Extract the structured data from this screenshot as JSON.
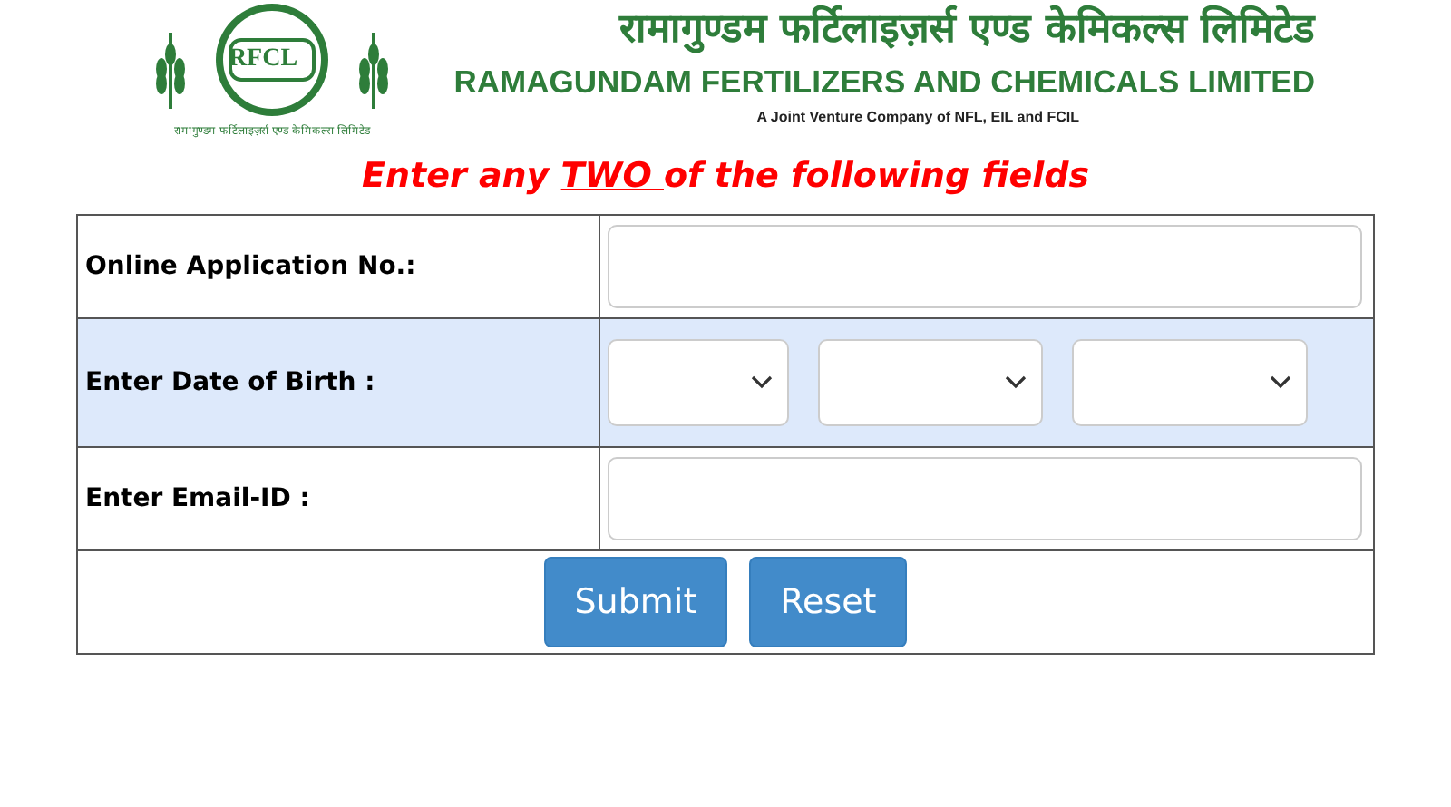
{
  "header": {
    "logo_text": "RFCL",
    "logo_caption": "रामागुण्डम फर्टिलाइज़र्स एण्ड केमिकल्स लिमिटेड",
    "title_hindi": "रामागुण्डम फर्टिलाइज़र्स एण्ड केमिकल्स लिमिटेड",
    "title_english": "RAMAGUNDAM FERTILIZERS AND CHEMICALS LIMITED",
    "subtitle": "A Joint Venture Company of NFL, EIL and FCIL"
  },
  "instruction": [
    {
      "text": "Enter any ",
      "underline": false
    },
    {
      "text": "TWO ",
      "underline": true
    },
    {
      "text": "of the following fields",
      "underline": false
    }
  ],
  "rows": [
    {
      "label": "Online Application No.:",
      "kind": "text",
      "highlighted": false
    },
    {
      "label": "Enter Date of Birth :",
      "kind": "date",
      "highlighted": true
    },
    {
      "label": "Enter Email-ID :",
      "kind": "text",
      "highlighted": false
    }
  ],
  "buttons": [
    "Submit",
    "Reset"
  ]
}
